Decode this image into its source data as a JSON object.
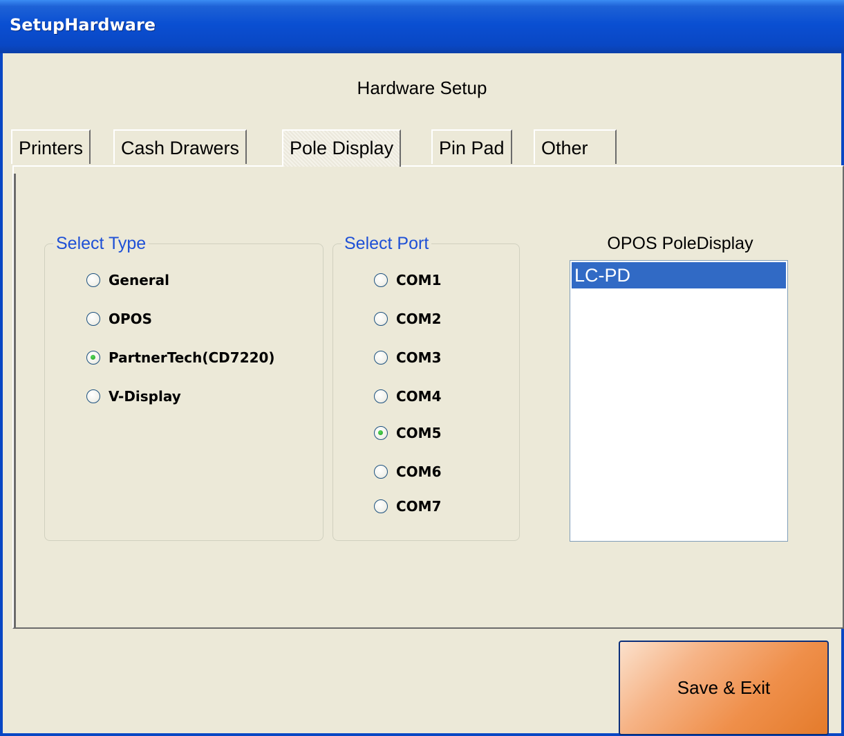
{
  "window": {
    "title": "SetupHardware"
  },
  "header": {
    "title": "Hardware Setup"
  },
  "tabs": [
    {
      "label": "Printers"
    },
    {
      "label": "Cash Drawers"
    },
    {
      "label": "Pole Display",
      "active": true
    },
    {
      "label": "Pin Pad"
    },
    {
      "label": "Other"
    }
  ],
  "select_type": {
    "legend": "Select Type",
    "options": [
      {
        "label": "General",
        "selected": false
      },
      {
        "label": "OPOS",
        "selected": false
      },
      {
        "label": "PartnerTech(CD7220)",
        "selected": true
      },
      {
        "label": "V-Display",
        "selected": false
      }
    ]
  },
  "select_port": {
    "legend": "Select Port",
    "options": [
      {
        "label": "COM1",
        "selected": false
      },
      {
        "label": "COM2",
        "selected": false
      },
      {
        "label": "COM3",
        "selected": false
      },
      {
        "label": "COM4",
        "selected": false
      },
      {
        "label": "COM5",
        "selected": true
      },
      {
        "label": "COM6",
        "selected": false
      },
      {
        "label": "COM7",
        "selected": false
      }
    ]
  },
  "opos_list": {
    "label": "OPOS PoleDisplay",
    "items": [
      {
        "label": "LC-PD",
        "selected": true
      }
    ]
  },
  "footer": {
    "save_label": "Save & Exit"
  },
  "colors": {
    "titlebar": "#0a4fd2",
    "window_bg": "#ece9d8",
    "legend_text": "#1e50d6",
    "selection": "#316ac5",
    "save_button": "#ef8f4a"
  }
}
